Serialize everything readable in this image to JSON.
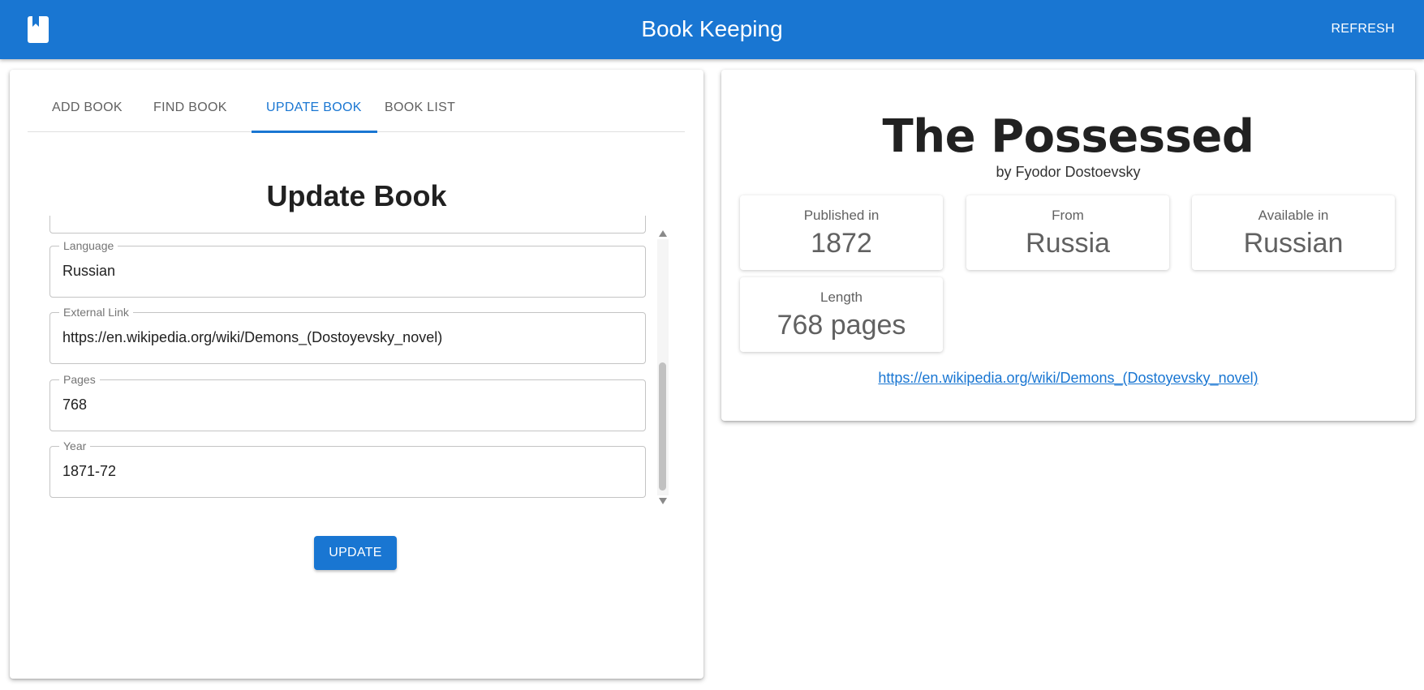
{
  "app": {
    "title": "Book Keeping",
    "refresh_label": "REFRESH",
    "logo_icon": "bookmark-book-icon"
  },
  "tabs": [
    {
      "label": "ADD BOOK"
    },
    {
      "label": "FIND BOOK"
    },
    {
      "label": "UPDATE BOOK",
      "active": true
    },
    {
      "label": "BOOK LIST"
    }
  ],
  "form": {
    "title": "Update Book",
    "fields": [
      {
        "label": "Language",
        "value": "Russian"
      },
      {
        "label": "External Link",
        "value": "https://en.wikipedia.org/wiki/Demons_(Dostoyevsky_novel)"
      },
      {
        "label": "Pages",
        "value": "768"
      },
      {
        "label": "Year",
        "value": "1871-72"
      }
    ],
    "update_label": "UPDATE"
  },
  "book": {
    "title": "The Possessed",
    "author": "by Fyodor Dostoevsky",
    "stats": [
      {
        "label": "Published in",
        "value": "1872"
      },
      {
        "label": "From",
        "value": "Russia"
      },
      {
        "label": "Available in",
        "value": "Russian"
      },
      {
        "label": "Length",
        "value": "768 pages"
      }
    ],
    "link": "https://en.wikipedia.org/wiki/Demons_(Dostoyevsky_novel)"
  },
  "colors": {
    "primary": "#1976d2",
    "background": "#ffffff"
  }
}
